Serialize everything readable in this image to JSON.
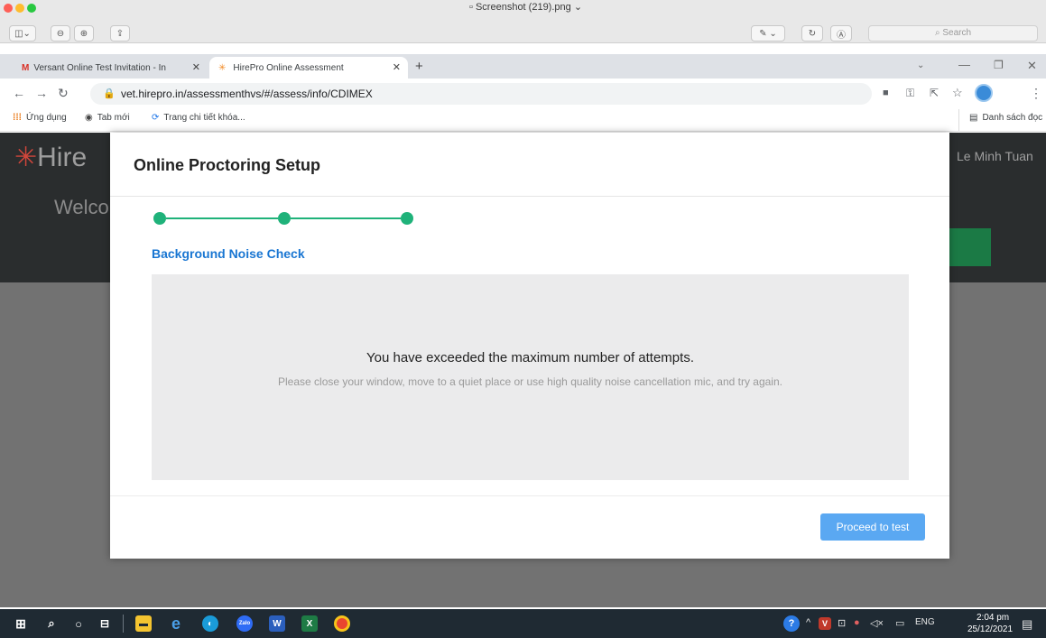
{
  "viewer": {
    "title": "Screenshot (219).png",
    "search_placeholder": "Search"
  },
  "tabs": [
    {
      "label": "Versant Online Test Invitation - In"
    },
    {
      "label": "HirePro Online Assessment"
    }
  ],
  "address_bar": {
    "url": "vet.hirepro.in/assessmenthvs/#/assess/info/CDIMEX"
  },
  "bookmarks": {
    "items": [
      "Ứng dụng",
      "Tab mới",
      "Trang chi tiết khóa..."
    ],
    "reading_list": "Danh sách đọc"
  },
  "page": {
    "brand": "Hire",
    "welcome": "Welco",
    "user_name": "Le Minh Tuan",
    "header_color": "#2a2d2e"
  },
  "modal": {
    "title": "Online Proctoring Setup",
    "step_title": "Background Noise Check",
    "steps_total": 3,
    "steps_completed": 3,
    "notice_heading": "You have exceeded the maximum number of attempts.",
    "notice_body": "Please close your window, move to a quiet place or use high quality noise cancellation mic, and try again.",
    "proceed_label": "Proceed to test",
    "accent_color": "#1fb27a",
    "link_color": "#1976d2",
    "button_color": "#5aa8f2"
  },
  "taskbar": {
    "language": "ENG",
    "time": "2:04 pm",
    "date": "25/12/2021"
  }
}
